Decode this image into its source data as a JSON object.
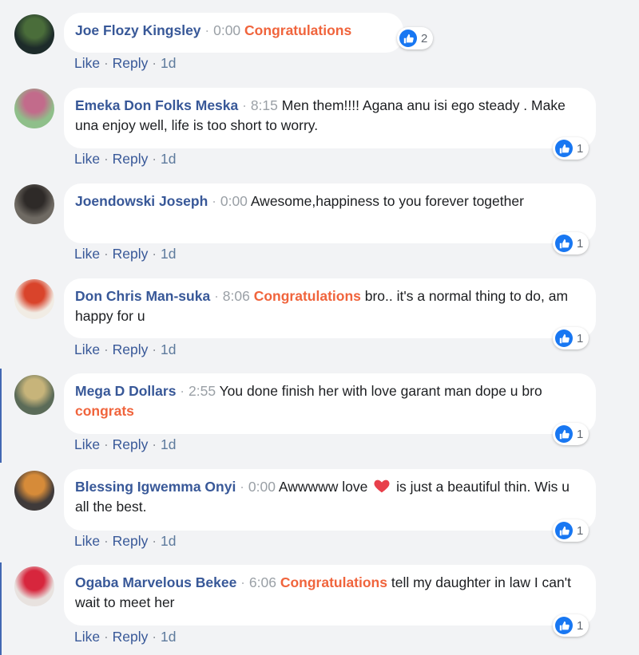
{
  "comments": [
    {
      "author": "Joe Flozy Kingsley",
      "time": "0:00",
      "parts": [
        {
          "text": "Congratulations",
          "highlight": true
        }
      ],
      "reactions": "2",
      "actions": {
        "like": "Like",
        "reply": "Reply",
        "age": "1d"
      },
      "avatar_colors": [
        "#1d2b2a",
        "#4a6d3a"
      ]
    },
    {
      "author": "Emeka Don Folks Meska",
      "time": "8:15",
      "parts": [
        {
          "text": "Men them!!!! Agana anu isi ego steady . Make una enjoy well, life is too short to worry.",
          "highlight": false
        }
      ],
      "reactions": "1",
      "actions": {
        "like": "Like",
        "reply": "Reply",
        "age": "1d"
      },
      "avatar_colors": [
        "#8fbf8a",
        "#c26b8b"
      ]
    },
    {
      "author": "Joendowski Joseph",
      "time": "0:00",
      "parts": [
        {
          "text": "Awesome,happiness to you forever together",
          "highlight": false
        }
      ],
      "reactions": "1",
      "actions": {
        "like": "Like",
        "reply": "Reply",
        "age": "1d"
      },
      "avatar_colors": [
        "#6f6a63",
        "#2e2a28"
      ]
    },
    {
      "author": "Don Chris Man-suka",
      "time": "8:06",
      "parts": [
        {
          "text": "Congratulations",
          "highlight": true
        },
        {
          "text": " bro.. it's a normal thing to do, am happy for u",
          "highlight": false
        }
      ],
      "reactions": "1",
      "actions": {
        "like": "Like",
        "reply": "Reply",
        "age": "1d"
      },
      "avatar_colors": [
        "#f1ece4",
        "#d9442b"
      ]
    },
    {
      "author": "Mega D Dollars",
      "time": "2:55",
      "parts": [
        {
          "text": "You done finish her with love garant man dope u bro ",
          "highlight": false
        },
        {
          "text": "congrats",
          "highlight": true
        }
      ],
      "reactions": "1",
      "actions": {
        "like": "Like",
        "reply": "Reply",
        "age": "1d"
      },
      "avatar_colors": [
        "#5b6b58",
        "#c7b47a"
      ]
    },
    {
      "author": "Blessing Igwemma Onyi",
      "time": "0:00",
      "parts": [
        {
          "text": "Awwwww love ",
          "highlight": false
        },
        {
          "text": "",
          "heart": true
        },
        {
          "text": " is just a beautiful thin. Wis u all the best.",
          "highlight": false
        }
      ],
      "reactions": "1",
      "actions": {
        "like": "Like",
        "reply": "Reply",
        "age": "1d"
      },
      "avatar_colors": [
        "#3f3a3a",
        "#d68b39"
      ]
    },
    {
      "author": "Ogaba Marvelous Bekee",
      "time": "6:06",
      "parts": [
        {
          "text": "Congratulations",
          "highlight": true
        },
        {
          "text": " tell my daughter in law I can't wait to meet her",
          "highlight": false
        }
      ],
      "reactions": "1",
      "actions": {
        "like": "Like",
        "reply": "Reply",
        "age": "1d"
      },
      "avatar_colors": [
        "#e8e2df",
        "#d7263d"
      ]
    }
  ],
  "icons": {
    "like": "thumbs-up-icon",
    "heart": "heart-emoji-icon"
  },
  "colors": {
    "author": "#385898",
    "highlight": "#f0643c",
    "reaction_blue": "#1877f2",
    "background": "#f2f3f5"
  }
}
